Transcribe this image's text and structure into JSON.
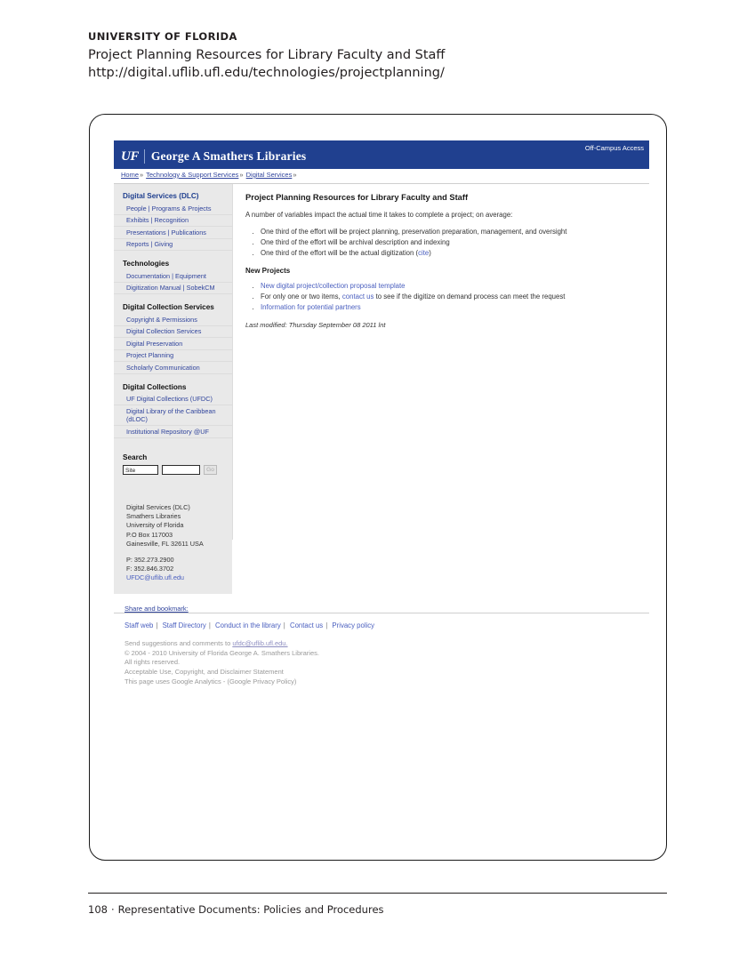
{
  "document": {
    "university": "UNIVERSITY OF FLORIDA",
    "title": "Project Planning Resources for Library Faculty and Staff",
    "url": "http://digital.uflib.ufl.edu/technologies/projectplanning/",
    "folio_page": "108",
    "folio_dot": "·",
    "folio_text": "Representative Documents:  Policies and Procedures"
  },
  "colors": {
    "banner_blue": "#20408f",
    "link_blue": "#4a5fbf",
    "sidebar_grey": "#e9e9e9"
  },
  "site": {
    "banner": {
      "logo": "UF",
      "title": "George A Smathers Libraries",
      "off_campus": "Off-Campus Access"
    },
    "breadcrumb": {
      "items": [
        "Home",
        "Technology & Support Services",
        "Digital Services"
      ],
      "separator": "»"
    },
    "sidebar": {
      "groups": [
        {
          "heading": "Digital Services (DLC)",
          "heading_color": "blue",
          "rows": [
            "People | Programs & Projects",
            "Exhibits | Recognition",
            "Presentations | Publications",
            "Reports | Giving"
          ]
        },
        {
          "heading": "Technologies",
          "heading_color": "dark",
          "rows": [
            "Documentation | Equipment",
            "Digitization Manual | SobekCM"
          ]
        },
        {
          "heading": "Digital Collection Services",
          "heading_color": "dark",
          "rows": [
            "Copyright & Permissions",
            "Digital Collection Services",
            "Digital Preservation",
            "Project Planning",
            "Scholarly Communication"
          ]
        },
        {
          "heading": "Digital Collections",
          "heading_color": "dark",
          "rows": [
            "UF Digital Collections (UFDC)",
            "Digital Library of the Caribbean (dLOC)",
            "Institutional Repository @UF"
          ]
        }
      ],
      "search": {
        "heading": "Search",
        "scope_value": "Site",
        "input_value": "",
        "input_placeholder": "",
        "go_label": "Go"
      },
      "address": [
        "Digital Services (DLC)",
        "Smathers Libraries",
        "University of Florida",
        "P.O Box 117003",
        "Gainesville, FL 32611 USA"
      ],
      "phone": "P: 352.273.2900",
      "fax": "F: 352.846.3702",
      "email": "UFDC@uflib.ufl.edu",
      "share_label": "Share and bookmark:"
    },
    "main": {
      "title": "Project Planning Resources for Library Faculty and Staff",
      "intro": "A number of variables impact the actual time it takes to complete a project; on average:",
      "bullets": [
        "One third of the effort will be project planning, preservation preparation, management, and oversight",
        "One third of the effort will be archival description and indexing",
        "One third of the effort will be the actual digitization ("
      ],
      "cite_link": "cite",
      "cite_close": ")",
      "subheading": "New Projects",
      "new_bullets": [
        "New digital project/collection proposal template",
        "Information for potential partners"
      ],
      "contact_bullet_pre": "For only one or two items, ",
      "contact_bullet_link": "contact us",
      "contact_bullet_post": " to see if the digitize on demand process can meet the request",
      "last_modified": "Last modified: Thursday September 08 2011 lnt"
    },
    "footer": {
      "links": [
        "Staff web",
        "Staff Directory",
        "Conduct in the library",
        "Contact us",
        "Privacy policy"
      ],
      "separator": "|",
      "suggest_pre": "Send suggestions and comments to ",
      "suggest_email": "ufdc@uflib.ufl.edu.",
      "copyright": "© 2004 - 2010 University of Florida George A. Smathers Libraries.",
      "rights": "All rights reserved.",
      "acceptable": "Acceptable Use, Copyright, and Disclaimer Statement",
      "analytics": "This page uses Google Analytics - (Google Privacy Policy)"
    }
  }
}
